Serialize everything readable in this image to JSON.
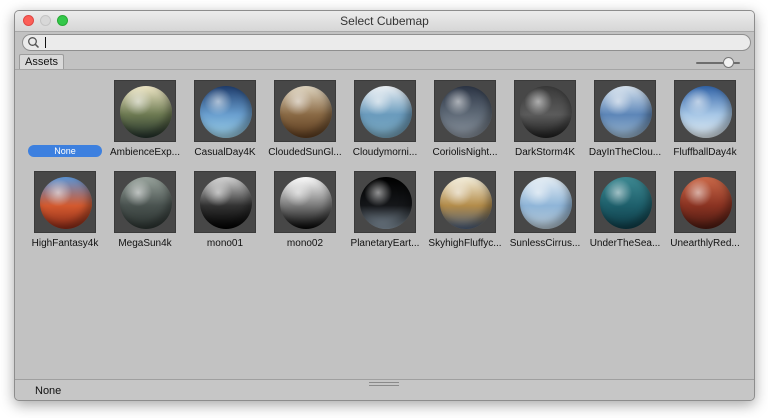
{
  "window": {
    "title": "Select Cubemap"
  },
  "search": {
    "value": "",
    "placeholder": ""
  },
  "tabs": [
    {
      "label": "Assets"
    }
  ],
  "none_item": {
    "label": "None"
  },
  "assets_row1": [
    {
      "label": "AmbienceExp...",
      "colors": [
        "#f1e9c8",
        "#6d7a52",
        "#22302a"
      ]
    },
    {
      "label": "CasualDay4K",
      "colors": [
        "#1f3d6d",
        "#6a9fcf",
        "#9ed2e8"
      ]
    },
    {
      "label": "CloudedSunGl...",
      "colors": [
        "#e0d6c1",
        "#8a6a45",
        "#5b3b1f"
      ]
    },
    {
      "label": "Cloudymorni...",
      "colors": [
        "#eef2f6",
        "#6a9bbd",
        "#7aa8bf"
      ]
    },
    {
      "label": "CoriolisNight...",
      "colors": [
        "#2c3545",
        "#606b78",
        "#8c95a0"
      ]
    },
    {
      "label": "DarkStorm4K",
      "colors": [
        "#3a3a3a",
        "#5b5b5b",
        "#1e1e1e"
      ]
    },
    {
      "label": "DayInTheClou...",
      "colors": [
        "#d8e4ef",
        "#5d86b8",
        "#9cb8cf"
      ]
    },
    {
      "label": "FluffballDay4k",
      "colors": [
        "#3264a8",
        "#a7c7e6",
        "#e2ecf2"
      ]
    }
  ],
  "assets_row2": [
    {
      "label": "HighFantasy4k",
      "colors": [
        "#5c96d8",
        "#d35a2f",
        "#8a2a18"
      ]
    },
    {
      "label": "MegaSun4k",
      "colors": [
        "#9aa59e",
        "#4a5350",
        "#2b3330"
      ]
    },
    {
      "label": "mono01",
      "colors": [
        "#d8d8d8",
        "#333333",
        "#000000"
      ]
    },
    {
      "label": "mono02",
      "colors": [
        "#ffffff",
        "#7a7a7a",
        "#050505"
      ]
    },
    {
      "label": "PlanetaryEart...",
      "colors": [
        "#000000",
        "#15171a",
        "#8a9aa8"
      ]
    },
    {
      "label": "SkyhighFluffyc...",
      "colors": [
        "#f6f1df",
        "#b38c4a",
        "#4b5e7a"
      ]
    },
    {
      "label": "SunlessCirrus...",
      "colors": [
        "#e8f0f6",
        "#8fb5d8",
        "#b7c8d4"
      ]
    },
    {
      "label": "UnderTheSea...",
      "colors": [
        "#3e8a93",
        "#1e5f6b",
        "#0f3c47"
      ]
    },
    {
      "label": "UnearthlyRed...",
      "colors": [
        "#cc6a4a",
        "#8a3322",
        "#4a1a12"
      ]
    }
  ],
  "status": {
    "selected": "None"
  }
}
